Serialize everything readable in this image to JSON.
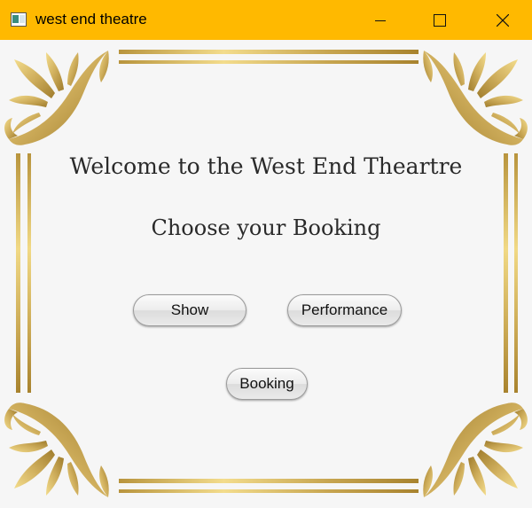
{
  "window": {
    "title": "west end theatre",
    "controls": {
      "minimize": "minimize-icon",
      "maximize": "maximize-icon",
      "close": "close-icon"
    },
    "titlebar_color": "#ffb900"
  },
  "main": {
    "welcome": "Welcome to the West End Theartre",
    "subtitle": "Choose your Booking",
    "buttons": {
      "show": "Show",
      "performance": "Performance",
      "booking": "Booking"
    }
  },
  "theme": {
    "gold_light": "#f3dc8c",
    "gold_dark": "#a8832e"
  }
}
